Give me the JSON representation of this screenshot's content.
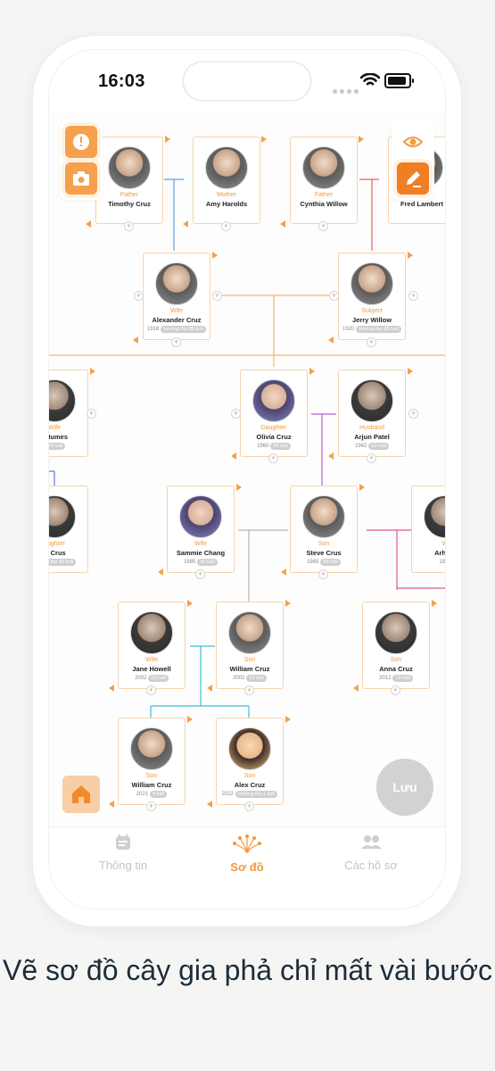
{
  "status": {
    "time": "16:03"
  },
  "toolbar": {
    "alert_icon": "alert-icon",
    "camera_icon": "camera-icon",
    "eye_icon": "eye-icon",
    "edit_icon": "edit-icon",
    "home_icon": "home-icon"
  },
  "tree": {
    "people": [
      {
        "role": "Father",
        "name": "Timothy Cruz",
        "year": "",
        "age": ""
      },
      {
        "role": "Mother",
        "name": "Amy Harolds",
        "year": "",
        "age": ""
      },
      {
        "role": "Father",
        "name": "Cynthia Willow",
        "year": "",
        "age": ""
      },
      {
        "role": "Mother",
        "name": "Fred Lambert",
        "year": "",
        "age": ""
      },
      {
        "role": "Wife",
        "name": "Alexander Cruz",
        "year": "1918",
        "age": "Hưởng thọ 85 tuổi"
      },
      {
        "role": "Subject",
        "name": "Jerry Willow",
        "year": "1920",
        "age": "Hưởng thọ 85 tuổi"
      },
      {
        "role": "Wife",
        "name": "r Humes",
        "year": "",
        "age": "70 tuổi"
      },
      {
        "role": "Daughter",
        "name": "Olivia Cruz",
        "year": "1960",
        "age": "65 tuổi"
      },
      {
        "role": "Husband",
        "name": "Arjun Patel",
        "year": "1962",
        "age": "63 tuổi"
      },
      {
        "role": "aughter",
        "name": "ie Crus",
        "year": "",
        "age": "ưởng thọ 45 tuổi"
      },
      {
        "role": "Wife",
        "name": "Sammie Chang",
        "year": "1985",
        "age": "40 tuổi"
      },
      {
        "role": "Son",
        "name": "Steve Crus",
        "year": "1985",
        "age": "39 tuổi"
      },
      {
        "role": "W",
        "name": "Arham",
        "year": "1983",
        "age": ""
      },
      {
        "role": "Wife",
        "name": "Jane Howell",
        "year": "2002",
        "age": "23 tuổi"
      },
      {
        "role": "Son",
        "name": "William Cruz",
        "year": "2002",
        "age": "23 tuổi"
      },
      {
        "role": "Son",
        "name": "Anna Cruz",
        "year": "2012",
        "age": "13 tuổi"
      },
      {
        "role": "Son",
        "name": "William Cruz",
        "year": "2021",
        "age": "4 tuổi"
      },
      {
        "role": "Son",
        "name": "Alex Cruz",
        "year": "2022",
        "age": "Hưởng thọ 1 tuổi"
      }
    ]
  },
  "actions": {
    "save_label": "Lưu"
  },
  "tabs": [
    {
      "label": "Thông tin",
      "icon": "calendar-icon",
      "active": false
    },
    {
      "label": "Sơ đồ",
      "icon": "tree-icon",
      "active": true
    },
    {
      "label": "Các hồ sơ",
      "icon": "people-icon",
      "active": false
    }
  ],
  "colors": {
    "accent": "#f29a3c",
    "blue_line": "#5aa0e0",
    "red_line": "#e0675e",
    "purple_line": "#b260d0",
    "pink_line": "#e0569a",
    "cyan_line": "#3cc0d8"
  },
  "caption": "Vẽ sơ đồ cây gia phả chỉ mất vài bước"
}
